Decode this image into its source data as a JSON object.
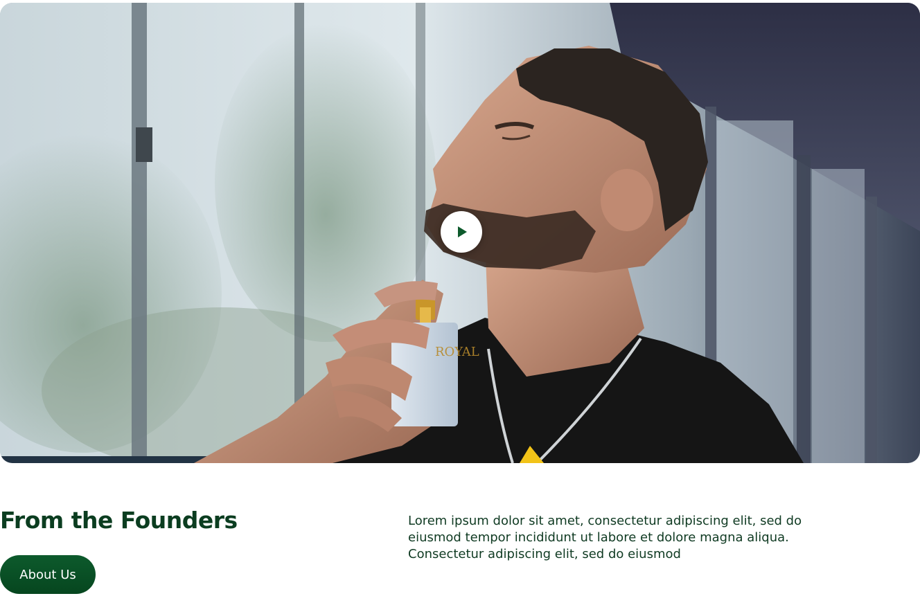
{
  "hero": {
    "media_type": "video",
    "play_icon": "play-icon",
    "bottle_label": "ROYAL"
  },
  "section": {
    "title": "From the Founders",
    "button_label": "About Us",
    "description": "Lorem ipsum dolor sit amet, consectetur adipiscing elit, sed do eiusmod tempor incididunt ut labore et dolore magna aliqua. Consectetur adipiscing elit, sed do eiusmod"
  },
  "colors": {
    "brand_green": "#0b3d20",
    "button_green": "#0a5127",
    "play_icon_green": "#0d5a2c",
    "text_dark_green": "#0f3a22",
    "background": "#ffffff"
  }
}
